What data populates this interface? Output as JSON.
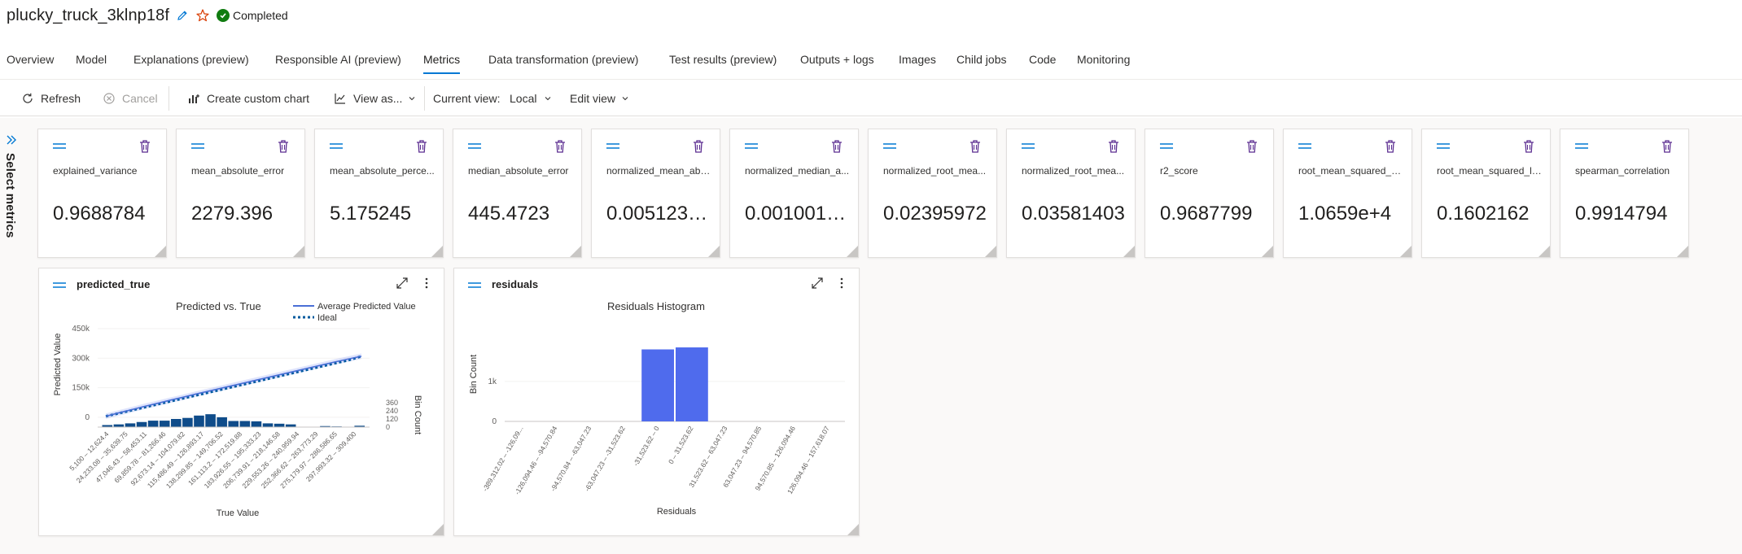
{
  "header": {
    "run_name": "plucky_truck_3klnp18f",
    "status": "Completed"
  },
  "tabs": [
    {
      "label": "Overview"
    },
    {
      "label": "Model"
    },
    {
      "label": "Explanations (preview)"
    },
    {
      "label": "Responsible AI (preview)"
    },
    {
      "label": "Metrics",
      "active": true
    },
    {
      "label": "Data transformation (preview)"
    },
    {
      "label": "Test results (preview)"
    },
    {
      "label": "Outputs + logs"
    },
    {
      "label": "Images"
    },
    {
      "label": "Child jobs"
    },
    {
      "label": "Code"
    },
    {
      "label": "Monitoring"
    }
  ],
  "toolbar": {
    "refresh": "Refresh",
    "cancel": "Cancel",
    "create_chart": "Create custom chart",
    "view_as": "View as...",
    "current_view_label": "Current view:",
    "current_view_value": "Local",
    "edit_view": "Edit view"
  },
  "sidebar": {
    "select_metrics": "Select metrics"
  },
  "metrics": [
    {
      "name": "explained_variance",
      "value": "0.9688784"
    },
    {
      "name": "mean_absolute_error",
      "value": "2279.396"
    },
    {
      "name": "mean_absolute_perce...",
      "value": "5.175245"
    },
    {
      "name": "median_absolute_error",
      "value": "445.4723"
    },
    {
      "name": "normalized_mean_abs...",
      "value": "0.0051237..."
    },
    {
      "name": "normalized_median_a...",
      "value": "0.0010013..."
    },
    {
      "name": "normalized_root_mea...",
      "value": "0.02395972"
    },
    {
      "name": "normalized_root_mea...",
      "value": "0.03581403"
    },
    {
      "name": "r2_score",
      "value": "0.9687799"
    },
    {
      "name": "root_mean_squared_er...",
      "value": "1.0659e+4"
    },
    {
      "name": "root_mean_squared_lo...",
      "value": "0.1602162"
    },
    {
      "name": "spearman_correlation",
      "value": "0.9914794"
    }
  ],
  "panels": {
    "predicted_true": {
      "title": "predicted_true"
    },
    "residuals": {
      "title": "residuals"
    }
  },
  "colors": {
    "accent": "#0078d4",
    "success": "#107c10",
    "trash": "#5c2e91",
    "bar_dark": "#0f4c8a",
    "bar_blue": "#4f6bed",
    "line": "#4a6fd6"
  },
  "chart_data": [
    {
      "type": "line",
      "title": "Predicted vs. True",
      "xlabel": "True Value",
      "ylabel": "Predicted Value",
      "y2label": "Bin Count",
      "legend": [
        "Average Predicted Value",
        "Ideal"
      ],
      "legend_position": "top-right",
      "y_ticks": [
        "450k",
        "300k",
        "150k",
        "0"
      ],
      "ylim": [
        -50000,
        450000
      ],
      "y2_ticks": [
        "360",
        "240",
        "120",
        "0"
      ],
      "y2lim": [
        0,
        360
      ],
      "categories": [
        "5,100 – 12,624.4",
        "24,233.08 – 35,639.75",
        "47,046.43 – 58,453.11",
        "69,859.78 – 81,266.46",
        "92,673.14 – 104,079.82",
        "115,486.49 – 126,893.17",
        "138,299.85 – 149,706.52",
        "161,113.2 – 172,519.88",
        "183,926.55 – 195,333.23",
        "206,739.91 – 218,146.58",
        "229,553.26 – 240,959.94",
        "252,366.62 – 263,773.29",
        "275,179.97 – 286,586.65",
        "297,993.32 – 309,400"
      ],
      "bin_count": [
        30,
        40,
        55,
        75,
        95,
        95,
        120,
        135,
        170,
        190,
        145,
        90,
        90,
        85,
        55,
        50,
        40,
        5,
        0,
        15,
        10,
        5,
        20
      ],
      "avg_predicted": [
        5000,
        22000,
        38000,
        55000,
        70000,
        86000,
        101000,
        117000,
        132000,
        147000,
        162000,
        177000,
        192000,
        207000,
        222000,
        237000,
        252000,
        267000,
        282000,
        296000,
        310000
      ],
      "ideal": [
        5000,
        20000,
        35000,
        50000,
        65000,
        80000,
        95000,
        110000,
        125000,
        140000,
        155000,
        170000,
        185000,
        200000,
        215000,
        230000,
        245000,
        260000,
        275000,
        290000,
        309400
      ]
    },
    {
      "type": "bar",
      "title": "Residuals Histogram",
      "xlabel": "Residuals",
      "ylabel": "Bin Count",
      "y_ticks": [
        "1k",
        "0"
      ],
      "ylim": [
        0,
        2400
      ],
      "categories": [
        "-389,312.02 – -126,09...",
        "-126,094.46 – -94,570.84",
        "-94,570.84 – -63,047.23",
        "-63,047.23 – -31,523.62",
        "-31,523.62 – 0",
        "0 – 31,523.62",
        "31,523.62 – 63,047.23",
        "63,047.23 – 94,570.85",
        "94,570.85 – 126,094.46",
        "126,094.46 – 157,618.07"
      ],
      "values": [
        0,
        0,
        0,
        0,
        1800,
        1850,
        0,
        0,
        0,
        0
      ]
    }
  ]
}
